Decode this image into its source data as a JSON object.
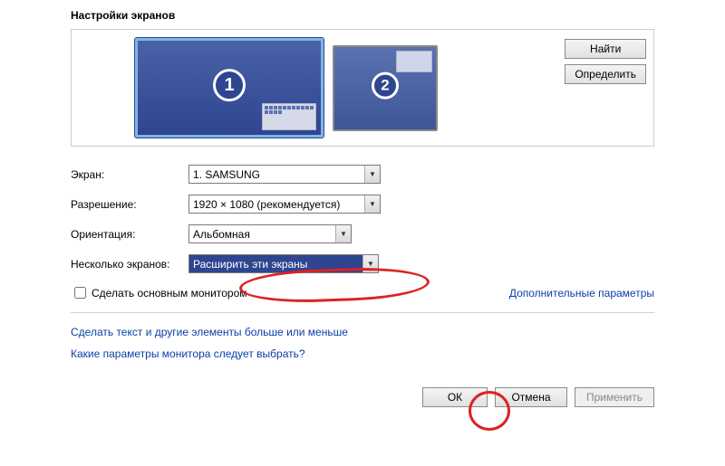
{
  "title": "Настройки экранов",
  "preview_buttons": {
    "find": "Найти",
    "detect": "Определить"
  },
  "monitors": {
    "primary_num": "1",
    "secondary_num": "2"
  },
  "labels": {
    "screen": "Экран:",
    "resolution": "Разрешение:",
    "orientation": "Ориентация:",
    "multiple": "Несколько экранов:"
  },
  "values": {
    "screen": "1. SAMSUNG",
    "resolution": "1920 × 1080 (рекомендуется)",
    "orientation": "Альбомная",
    "multiple": "Расширить эти экраны"
  },
  "checkbox_label": "Сделать основным монитором",
  "advanced_link": "Дополнительные параметры",
  "help_links": {
    "text_size": "Сделать текст и другие элементы больше или меньше",
    "which_params": "Какие параметры монитора следует выбрать?"
  },
  "buttons": {
    "ok": "ОК",
    "cancel": "Отмена",
    "apply": "Применить"
  }
}
